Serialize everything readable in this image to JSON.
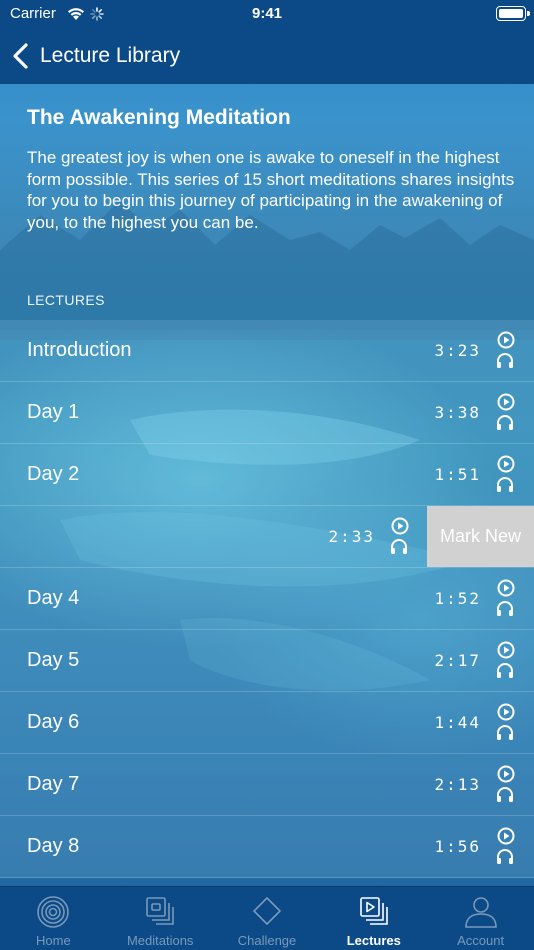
{
  "status_bar": {
    "carrier": "Carrier",
    "time": "9:41",
    "icons": [
      "wifi-icon",
      "spinner-icon",
      "battery-icon"
    ]
  },
  "nav": {
    "back_label": "Lecture Library",
    "back_icon": "chevron-left-icon"
  },
  "series": {
    "title": "The Awakening Meditation",
    "description": "The greatest joy is when one is awake to oneself in the highest form possible. This series of 15 short meditations shares insights for you to begin this journey of participating in the awakening of you, to the highest you can be."
  },
  "section": {
    "label": "LECTURES"
  },
  "lectures": [
    {
      "name": "Introduction",
      "duration": "3:23",
      "icons": [
        "play-icon",
        "headphones-icon"
      ]
    },
    {
      "name": "Day 1",
      "duration": "3:38",
      "icons": [
        "play-icon",
        "headphones-icon"
      ]
    },
    {
      "name": "Day 2",
      "duration": "1:51",
      "icons": [
        "play-icon",
        "headphones-icon"
      ]
    },
    {
      "name": "",
      "duration": "2:33",
      "swiped": true,
      "action_label": "Mark New",
      "icons": [
        "play-icon",
        "headphones-icon"
      ]
    },
    {
      "name": "Day 4",
      "duration": "1:52",
      "icons": [
        "play-icon",
        "headphones-icon"
      ]
    },
    {
      "name": "Day 5",
      "duration": "2:17",
      "icons": [
        "play-icon",
        "headphones-icon"
      ]
    },
    {
      "name": "Day 6",
      "duration": "1:44",
      "icons": [
        "play-icon",
        "headphones-icon"
      ]
    },
    {
      "name": "Day 7",
      "duration": "2:13",
      "icons": [
        "play-icon",
        "headphones-icon"
      ]
    },
    {
      "name": "Day 8",
      "duration": "1:56",
      "icons": [
        "play-icon",
        "headphones-icon"
      ]
    }
  ],
  "tabs": [
    {
      "label": "Home",
      "icon": "concentric-circles-icon",
      "active": false
    },
    {
      "label": "Meditations",
      "icon": "stacked-squares-icon",
      "active": false
    },
    {
      "label": "Challenge",
      "icon": "diamond-icon",
      "active": false
    },
    {
      "label": "Lectures",
      "icon": "stacked-play-icon",
      "active": true
    },
    {
      "label": "Account",
      "icon": "person-icon",
      "active": false
    }
  ],
  "colors": {
    "bar_background": "#0b4a87",
    "inactive_tab": "#7a99b9",
    "active_tab": "#ffffff",
    "swipe_action": "#d1d1d1"
  }
}
